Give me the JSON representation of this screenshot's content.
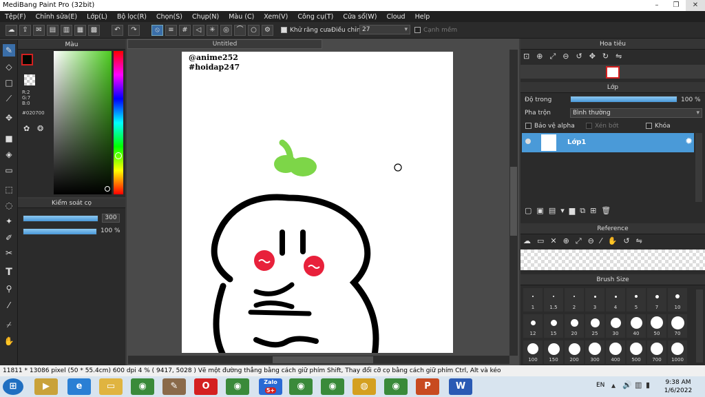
{
  "window": {
    "title": "MediBang Paint Pro (32bit)",
    "min": "–",
    "max": "❐",
    "close": "✕"
  },
  "menu": [
    "Tệp(F)",
    "Chỉnh sửa(E)",
    "Lớp(L)",
    "Bộ lọc(R)",
    "Chọn(S)",
    "Chụp(N)",
    "Màu (C)",
    "Xem(V)",
    "Công cụ(T)",
    "Cửa sổ(W)",
    "Cloud",
    "Help"
  ],
  "toolbar": {
    "antialias_label": "Khử răng cưa",
    "correction_label": "Điều chỉnh",
    "correction_value": "27",
    "snap_label": "Cạnh mềm"
  },
  "color_panel": {
    "title": "Màu",
    "r": "R:2",
    "g": "G:7",
    "b": "B:0",
    "hex": "#020700",
    "fg_color": "#020700",
    "accent": "#d42020"
  },
  "brush_control": {
    "title": "Kiểm soát cọ",
    "size": "300",
    "opacity": "100 %"
  },
  "document": {
    "tab": "Untitled",
    "text1": "@anime252",
    "text2": "#hoidap247"
  },
  "navigator": {
    "title": "Hoa tiêu"
  },
  "layer_panel": {
    "title": "Lớp",
    "opacity_label": "Độ trong",
    "opacity_value": "100 %",
    "blend_label": "Pha trộn",
    "blend_value": "Bình thường",
    "protect_alpha": "Bảo vệ alpha",
    "clipping": "Xén bớt",
    "lock": "Khóa",
    "layer_name": "Lớp1"
  },
  "reference": {
    "title": "Reference"
  },
  "brush_size": {
    "title": "Brush Size",
    "sizes": [
      "1",
      "1.5",
      "2",
      "3",
      "4",
      "5",
      "7",
      "10",
      "12",
      "15",
      "20",
      "25",
      "30",
      "40",
      "50",
      "70",
      "100",
      "150",
      "200",
      "300",
      "400",
      "500",
      "700",
      "1000"
    ]
  },
  "status": {
    "text": "11811 * 13086 pixel   (50 * 55.4cm)   600 dpi   4 %   ( 9417, 5028 )   Vẽ một đường thẳng bằng cách giữ phím Shift, Thay đổi cỡ cọ bằng cách giữ phím Ctrl, Alt và kéo"
  },
  "taskbar": {
    "lang": "EN",
    "time": "9:38 AM",
    "date": "1/6/2022",
    "zalo": "Zalo",
    "zalo_badge": "5+"
  }
}
